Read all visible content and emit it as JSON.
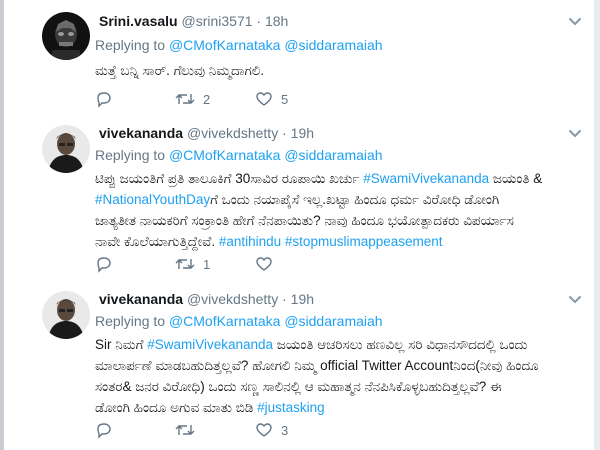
{
  "tweets": [
    {
      "name": "Srini.vasalu",
      "handle": "@srini3571",
      "time": "18h",
      "replying_prefix": "Replying to",
      "mentions": [
        "@CMofKarnataka",
        "@siddaramaiah"
      ],
      "text": "ಮತ್ತೆ ಬನ್ನಿ ಸಾರ್. ಗೆಲುವು ನಿಮ್ಮದಾಗಲಿ.",
      "replies": "",
      "retweets": "2",
      "likes": "5"
    },
    {
      "name": "vivekananda",
      "handle": "@vivekdshetty",
      "time": "19h",
      "replying_prefix": "Replying to",
      "mentions": [
        "@CMofKarnataka",
        "@siddaramaiah"
      ],
      "lines": [
        [
          "ಟಿಪ್ಪು ಜಯಂತಿಗೆ ಪ್ರತಿ ತಾಲೂಕಿಗೆ 30ಸಾವಿರ ರೂಪಾಯಿ ಖರ್ಚು ",
          "#SwamiVivekananda",
          " ಜಯಂತಿ &"
        ],
        [
          "#NationalYouthDay",
          "ಗೆ ಒಂದು ನಯಾಪೈಸೆ ಇಲ್ಲ.ಖಟ್ಟಾ ಹಿಂದೂ ಧರ್ಮ ವಿರೋಧಿ ಡೋಂಗಿ"
        ],
        [
          "ಜಾತ್ಯತೀತ ನಾಯಕರಿಗೆ ಸಂಕ್ರಾಂತಿ ಹೇಗೆ ನೆನಪಾಯಿತು? ನಾವು ಹಿಂದೂ ಭಯೋತ್ಪಾದಕರು ವಿಪರ್ಯಾಸ"
        ],
        [
          "ನಾವೇ ಕೊಲೆಯಾಗುತ್ತಿದ್ದೇವೆ. ",
          "#antihindu",
          " ",
          "#stopmuslimappeasement"
        ]
      ],
      "replies": "",
      "retweets": "1",
      "likes": ""
    },
    {
      "name": "vivekananda",
      "handle": "@vivekdshetty",
      "time": "19h",
      "replying_prefix": "Replying to",
      "mentions": [
        "@CMofKarnataka",
        "@siddaramaiah"
      ],
      "lines": [
        [
          "Sir ನಿಮಗೆ ",
          "#SwamiVivekananda",
          " ಜಯಂತಿ ಆಚರಿಸಲು ಹಣವಿಲ್ಲ ಸರಿ ವಿಧಾನಸೌದದಲ್ಲಿ ಒಂದು"
        ],
        [
          "ಮಾಲಾರ್ಪಣೆ ಮಾಡಬಹುದಿತ್ತಲ್ಲವೆ? ಹೋಗಲಿ ನಿಮ್ಮ official Twitter Accountನಿಂದ(ನೀವು ಹಿಂದೂ"
        ],
        [
          "ಸಂತರ& ಜನರ ವಿರೋಧಿ) ಒಂದು ಸಣ್ಣ ಸಾಲಿನಲ್ಲಿ ಆ ಮಹಾತ್ಮನ ನೆನಪಿಸಿಕೊಳ್ಳಬಹುದಿತ್ತಲ್ಲವೆ? ಈ"
        ],
        [
          "ಡೋಂಗಿ ಹಿಂದೂ ಅಗುವ ಮಾತು ಬಿಡಿ ",
          "#justasking"
        ]
      ],
      "replies": "",
      "retweets": "",
      "likes": "3"
    }
  ],
  "icons": {
    "reply": "reply-icon",
    "retweet": "retweet-icon",
    "like": "heart-icon",
    "menu": "chevron-down-icon"
  },
  "colors": {
    "link": "#1da1f2",
    "muted": "#657786",
    "text": "#14171a",
    "divider": "#e6ecf0"
  }
}
